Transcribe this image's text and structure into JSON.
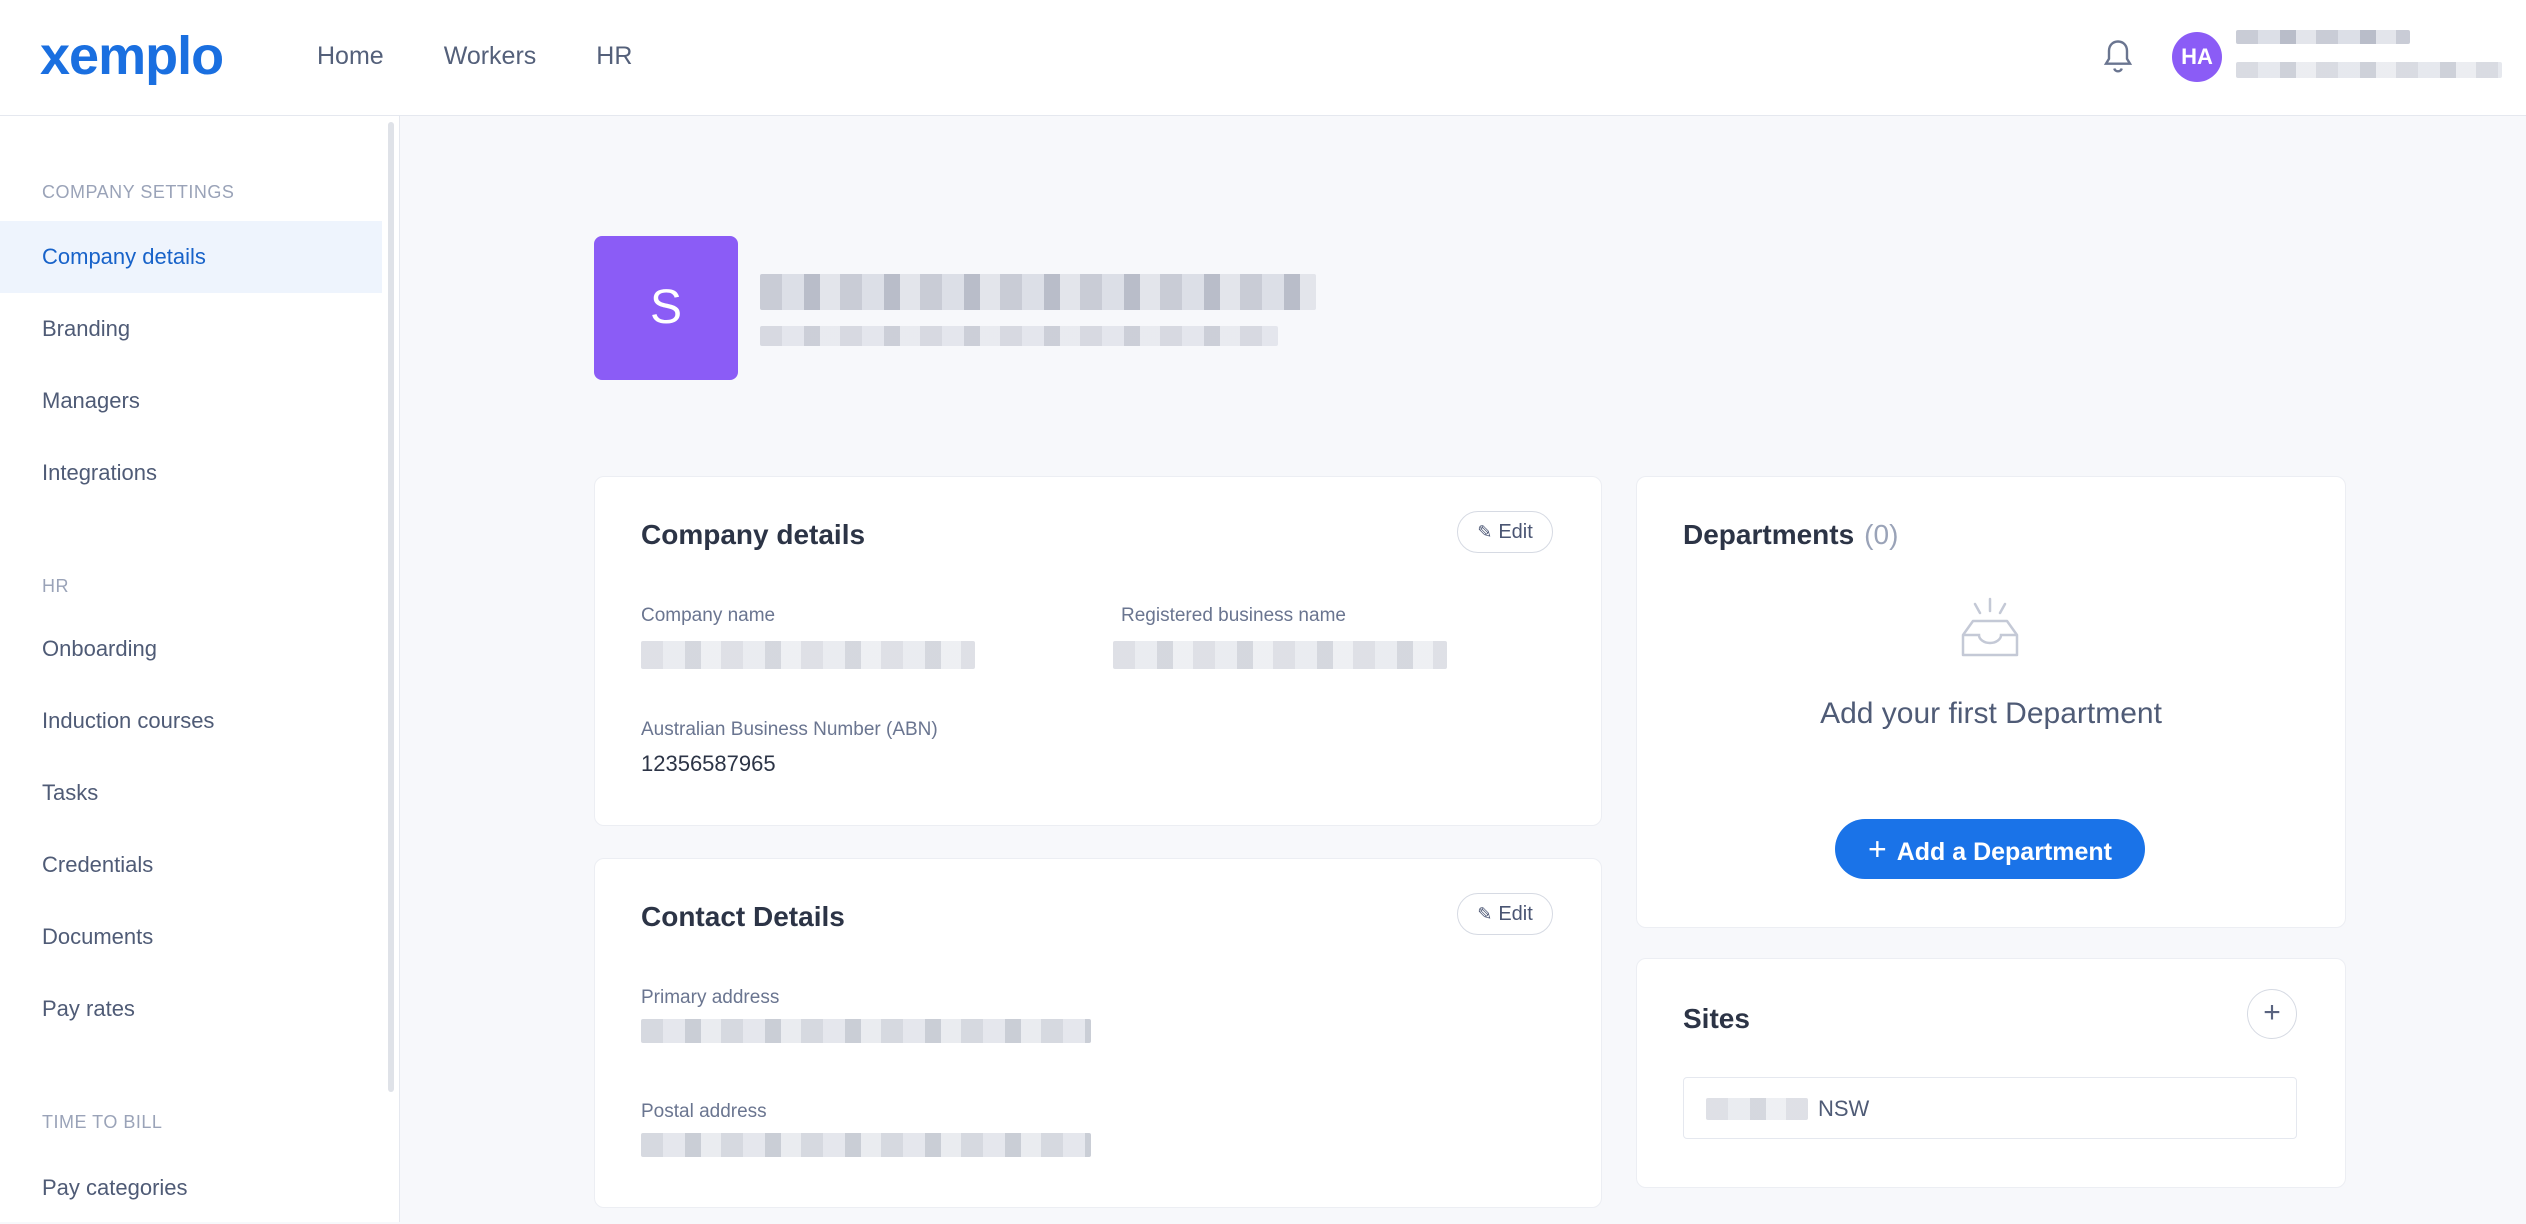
{
  "header": {
    "logo": "xemplo",
    "nav": [
      "Home",
      "Workers",
      "HR"
    ],
    "user_initials": "HA"
  },
  "sidebar": {
    "sections": [
      {
        "label": "COMPANY SETTINGS",
        "items": [
          "Company details",
          "Branding",
          "Managers",
          "Integrations"
        ]
      },
      {
        "label": "HR",
        "items": [
          "Onboarding",
          "Induction courses",
          "Tasks",
          "Credentials",
          "Documents",
          "Pay rates"
        ]
      },
      {
        "label": "TIME TO BILL",
        "items": [
          "Pay categories"
        ]
      }
    ],
    "active_item": "Company details"
  },
  "company": {
    "avatar_letter": "S"
  },
  "company_details": {
    "title": "Company details",
    "edit_label": "Edit",
    "company_name_label": "Company name",
    "registered_name_label": "Registered business name",
    "abn_label": "Australian Business Number (ABN)",
    "abn_value": "12356587965"
  },
  "contact_details": {
    "title": "Contact Details",
    "edit_label": "Edit",
    "primary_address_label": "Primary address",
    "postal_address_label": "Postal address"
  },
  "departments": {
    "title": "Departments",
    "count": "(0)",
    "empty_title": "Add your first Department",
    "add_button": "Add a Department"
  },
  "sites": {
    "title": "Sites",
    "items": [
      {
        "state": "NSW"
      }
    ]
  },
  "colors": {
    "brand": "#1a6fe0",
    "accent": "#1a73e8",
    "avatar": "#8b5cf6",
    "active_bg": "#eef4fd"
  }
}
